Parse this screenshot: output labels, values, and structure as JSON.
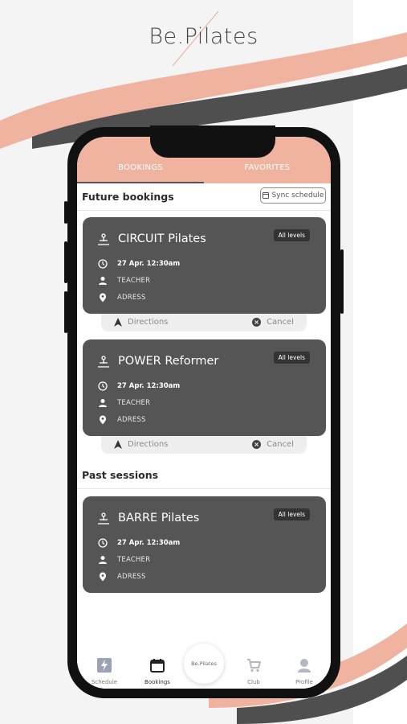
{
  "brand": {
    "logo_text": "Be.Pilates",
    "colors": {
      "salmon": "#efb3a0",
      "dark_stripe": "#4f4f4f",
      "card": "#555555"
    }
  },
  "tabs": [
    {
      "label": "BOOKINGS",
      "active": true
    },
    {
      "label": "FAVORITES",
      "active": false
    }
  ],
  "future": {
    "title": "Future bookings",
    "sync_label": "Sync schedule",
    "sync_icon": "calendar-icon"
  },
  "past": {
    "title": "Past sessions"
  },
  "bookings": [
    {
      "title": "CIRCUIT Pilates",
      "level": "All levels",
      "datetime": "27 Apr. 12:30am",
      "teacher": "TEACHER",
      "address": "ADRESS"
    },
    {
      "title": "POWER Reformer",
      "level": "All levels",
      "datetime": "27 Apr. 12:30am",
      "teacher": "TEACHER",
      "address": "ADRESS"
    }
  ],
  "past_sessions": [
    {
      "title": "BARRE Pilates",
      "level": "All levels",
      "datetime": "27 Apr. 12:30am",
      "teacher": "TEACHER",
      "address": "ADRESS"
    }
  ],
  "actions": {
    "directions": "Directions",
    "cancel": "Cancel"
  },
  "nav": {
    "items": [
      {
        "label": "Schedule",
        "icon": "bolt-icon"
      },
      {
        "label": "Bookings",
        "icon": "calendar-icon",
        "active": true
      },
      {
        "label": "Club",
        "icon": "cart-icon"
      },
      {
        "label": "Profile",
        "icon": "user-icon"
      }
    ],
    "center_logo": "Be.Pilates"
  }
}
